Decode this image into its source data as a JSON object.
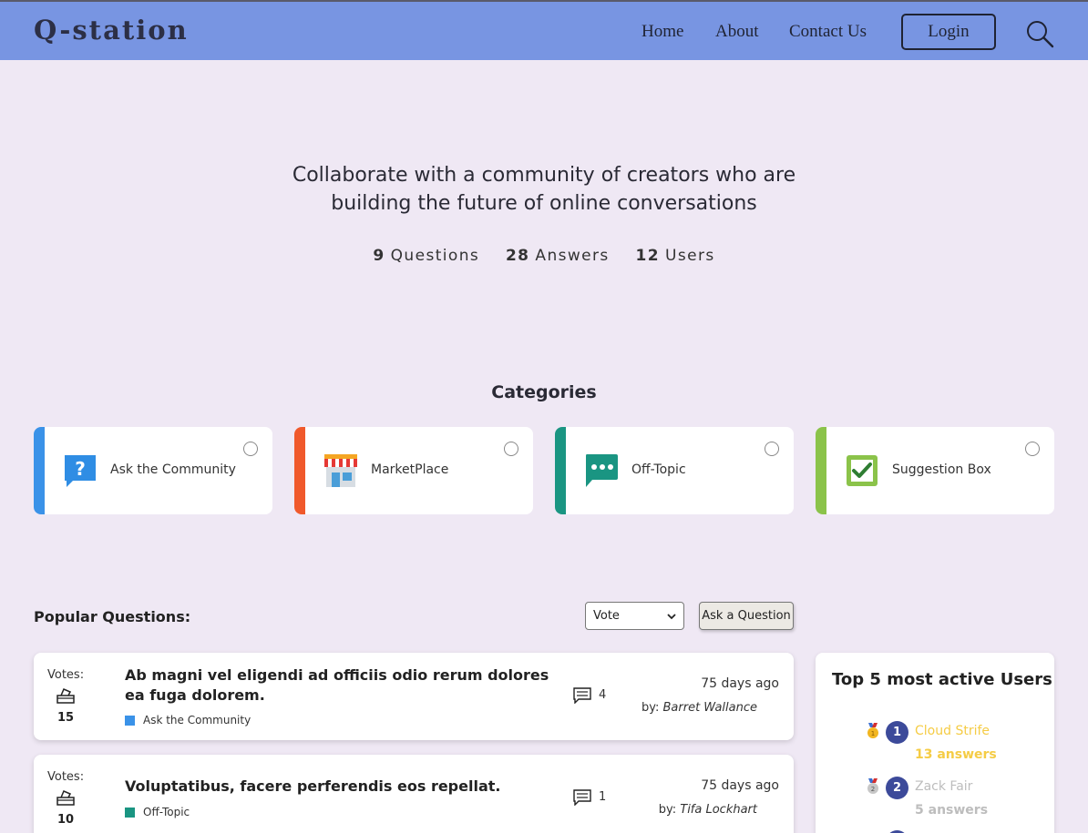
{
  "header": {
    "logo": "Q-station",
    "nav": [
      "Home",
      "About",
      "Contact Us"
    ],
    "login_label": "Login",
    "search_icon": "search-icon"
  },
  "hero": {
    "title": "Collaborate with a community of creators who are building the future of online conversations",
    "stats": [
      {
        "value": "9",
        "label": "Questions"
      },
      {
        "value": "28",
        "label": "Answers"
      },
      {
        "value": "12",
        "label": "Users"
      }
    ]
  },
  "categories": {
    "title": "Categories",
    "items": [
      {
        "label": "Ask the Community",
        "color": "#3a92e8",
        "icon": "question-bubble-icon"
      },
      {
        "label": "MarketPlace",
        "color": "#f0592b",
        "icon": "store-icon"
      },
      {
        "label": "Off-Topic",
        "color": "#1a9582",
        "icon": "chat-dots-icon"
      },
      {
        "label": "Suggestion Box",
        "color": "#8bc34a",
        "icon": "checkbox-icon"
      }
    ]
  },
  "popular": {
    "label": "Popular Questions:",
    "sort_selected": "Vote",
    "ask_label": "Ask a Question",
    "questions": [
      {
        "votes_label": "Votes:",
        "votes": "15",
        "title": "Ab magni vel eligendi ad officiis odio rerum dolores ea fuga dolorem.",
        "category": "Ask the Community",
        "category_color": "#3a92e8",
        "comments": "4",
        "date": "75 days ago",
        "by_label": "by:",
        "author": "Barret Wallance"
      },
      {
        "votes_label": "Votes:",
        "votes": "10",
        "title": "Voluptatibus, facere perferendis eos repellat.",
        "category": "Off-Topic",
        "category_color": "#1a9582",
        "comments": "1",
        "date": "75 days ago",
        "by_label": "by:",
        "author": "Tifa Lockhart"
      }
    ]
  },
  "top_users": {
    "title": "Top 5 most active Users",
    "users": [
      {
        "rank": "1",
        "name": "Cloud Strife",
        "answers": "13 answers",
        "color": "#f5cc45",
        "medal": "gold-medal-icon"
      },
      {
        "rank": "2",
        "name": "Zack Fair",
        "answers": "5 answers",
        "color": "#bdbdbd",
        "medal": "silver-medal-icon"
      }
    ]
  }
}
